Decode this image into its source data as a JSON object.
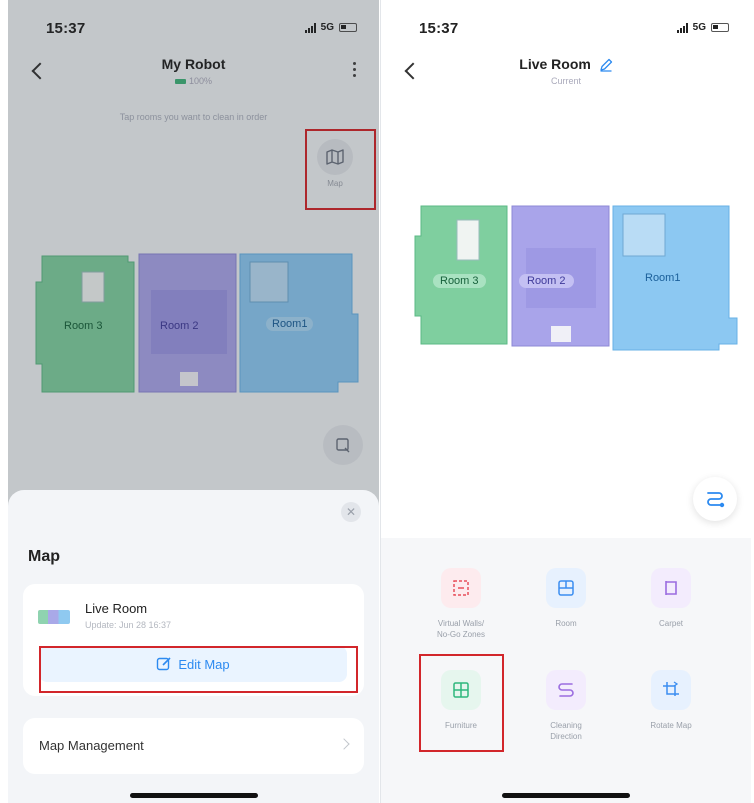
{
  "status_bar": {
    "time": "15:37",
    "network": "5G"
  },
  "left_screen": {
    "title": "My Robot",
    "battery_text": "100%",
    "hint": "Tap rooms you want to clean in order",
    "map_button_label": "Map",
    "rooms": [
      "Room 3",
      "Room 2",
      "Room1"
    ],
    "sheet": {
      "title": "Map",
      "map_name": "Live Room",
      "map_updated": "Update: Jun 28 16:37",
      "edit_map_label": "Edit Map",
      "map_management_label": "Map Management"
    }
  },
  "right_screen": {
    "title": "Live Room",
    "subtitle": "Current",
    "rooms": [
      "Room 3",
      "Room 2",
      "Room1"
    ],
    "tools": [
      {
        "label": "Virtual Walls/\nNo-Go Zones",
        "icon": "virtual-wall-icon",
        "color": "#e8505b"
      },
      {
        "label": "Room",
        "icon": "room-icon",
        "color": "#3b8ef0"
      },
      {
        "label": "Carpet",
        "icon": "carpet-icon",
        "color": "#9b6de0"
      },
      {
        "label": "Furniture",
        "icon": "furniture-icon",
        "color": "#2fb77d"
      },
      {
        "label": "Cleaning\nDirection",
        "icon": "cleaning-direction-icon",
        "color": "#9b6de0"
      },
      {
        "label": "Rotate Map",
        "icon": "rotate-map-icon",
        "color": "#3b8ef0"
      }
    ]
  },
  "colors": {
    "accent_blue": "#2c8af0",
    "highlight_red": "#d2262b",
    "room_green": "#7fcf9f",
    "room_purple": "#a9a4ea",
    "room_blue": "#8cc8f2"
  }
}
